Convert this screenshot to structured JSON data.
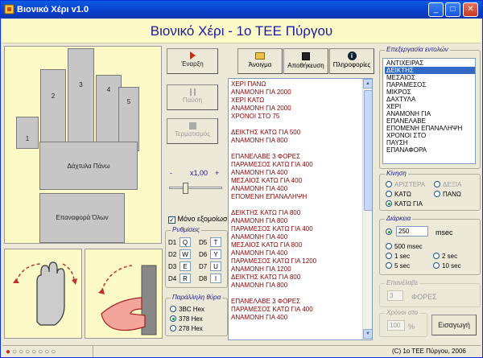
{
  "window": {
    "title": "Βιονικό Χέρι v1.0"
  },
  "banner": "Βιονικό Χέρι  -  1ο ΤΕΕ Πύργου",
  "hand": {
    "fingers": [
      "1",
      "2",
      "3",
      "4",
      "5"
    ],
    "palm_label": "Δάχτυλα Πάνω",
    "reset_label": "Επαναφορά Όλων"
  },
  "controls": {
    "start": "Έναρξη",
    "pause": "Παύση",
    "stop": "Τερματισμός",
    "speed_minus": "-",
    "speed_value": "x1,00",
    "speed_plus": "+",
    "single_sim": "Μόνο εξομοίωση",
    "keys_title": "Ρυθμίσεις",
    "keys": [
      {
        "d": "D1",
        "k": "Q"
      },
      {
        "d": "D5",
        "k": "T"
      },
      {
        "d": "D2",
        "k": "W"
      },
      {
        "d": "D6",
        "k": "Y"
      },
      {
        "d": "D3",
        "k": "E"
      },
      {
        "d": "D7",
        "k": "U"
      },
      {
        "d": "D4",
        "k": "R"
      },
      {
        "d": "D8",
        "k": "I"
      }
    ],
    "port_title": "Παράλληλη θύρα",
    "ports": [
      "3BC Hex",
      "378 Hex",
      "278 Hex"
    ]
  },
  "toolbar": {
    "open": "Άνοιγμα",
    "save": "Αποθήκευση",
    "info": "Πληροφορίες"
  },
  "program": [
    "ΧΕΡΙ ΠΑΝΩ",
    "ΑΝΑΜΟΝΗ ΓΙΑ 2000",
    "ΧΕΡΙ ΚΑΤΩ",
    "ΑΝΑΜΟΝΗ ΓΙΑ 2000",
    "ΧΡΟΝΟΙ ΣΤΟ 75",
    "",
    "ΔΕΙΚΤΗΣ ΚΑΤΩ ΓΙΑ 500",
    "ΑΝΑΜΟΝΗ ΓΙΑ 800",
    "",
    "ΕΠΑΝΕΛΑΒΕ 3 ΦΟΡΕΣ",
    "ΠΑΡΑΜΕΣΟΣ ΚΑΤΩ ΓΙΑ 400",
    "ΑΝΑΜΟΝΗ ΓΙΑ 400",
    "ΜΕΣΑΙΟΣ ΚΑΤΩ ΓΙΑ 400",
    "ΑΝΑΜΟΝΗ ΓΙΑ 400",
    "ΕΠΟΜΕΝΗ ΕΠΑΝΑΛΗΨΗ",
    "",
    "ΔΕΙΚΤΗΣ ΚΑΤΩ ΓΙΑ 800",
    "ΑΝΑΜΟΝΗ ΓΙΑ 800",
    "ΠΑΡΑΜΕΣΟΣ ΚΑΤΩ ΓΙΑ 400",
    "ΑΝΑΜΟΝΗ ΓΙΑ 400",
    "ΜΕΣΑΙΟΣ ΚΑΤΩ ΓΙΑ 800",
    "ΑΝΑΜΟΝΗ ΓΙΑ 400",
    "ΠΑΡΑΜΕΣΟΣ ΚΑΤΩ ΓΙΑ 1200",
    "ΑΝΑΜΟΝΗ ΓΙΑ 1200",
    "ΔΕΙΚΤΗΣ ΚΑΤΩ ΓΙΑ 800",
    "ΑΝΑΜΟΝΗ ΓΙΑ 800",
    "",
    "ΕΠΑΝΕΛΑΒΕ 3 ΦΟΡΕΣ",
    "ΠΑΡΑΜΕΣΟΣ ΚΑΤΩ ΓΙΑ 400",
    "ΑΝΑΜΟΝΗ ΓΙΑ 400"
  ],
  "editor": {
    "title": "Επεξεργασία εντολών",
    "commands": [
      "ΑΝΤΙΧΕΙΡΑΣ",
      "ΔΕΙΚΤΗΣ",
      "ΜΕΣΑΙΟΣ",
      "ΠΑΡΑΜΕΣΟΣ",
      "ΜΙΚΡΟΣ",
      "ΔΑΧΤΥΛΑ",
      "ΧΕΡΙ",
      "ΑΝΑΜΟΝΗ ΓΙΑ",
      "ΕΠΑΝΕΛΑΒΕ",
      "ΕΠΟΜΕΝΗ ΕΠΑΝΑΛΗΨΗ",
      "ΧΡΟΝΟΙ ΣΤΟ",
      "ΠΑΥΣΗ",
      "ΕΠΑΝΑΦΟΡΑ"
    ],
    "selected_index": 1,
    "motion_title": "Κίνηση",
    "motion": [
      "ΑΡΙΣΤΕΡΑ",
      "ΔΕΞΙΑ",
      "ΚΑΤΩ",
      "ΠΑΝΩ",
      "ΚΑΤΩ ΓΙΑ"
    ],
    "duration_title": "Διάρκεια",
    "duration_value": "250",
    "duration_unit": "msec",
    "durations": [
      "500 msec",
      "1 sec",
      "2 sec",
      "5 sec",
      "10 sec"
    ],
    "repeat_title": "Επανέλαβε",
    "repeat_value": "3",
    "repeat_unit": "ΦΟΡΕΣ",
    "times_title": "Χρόνοι στο",
    "times_value": "100",
    "times_unit": "%",
    "insert": "Εισαγωγή"
  },
  "status": {
    "copyright": "(C) 1ο ΤΕΕ Πύργου, 2006"
  }
}
